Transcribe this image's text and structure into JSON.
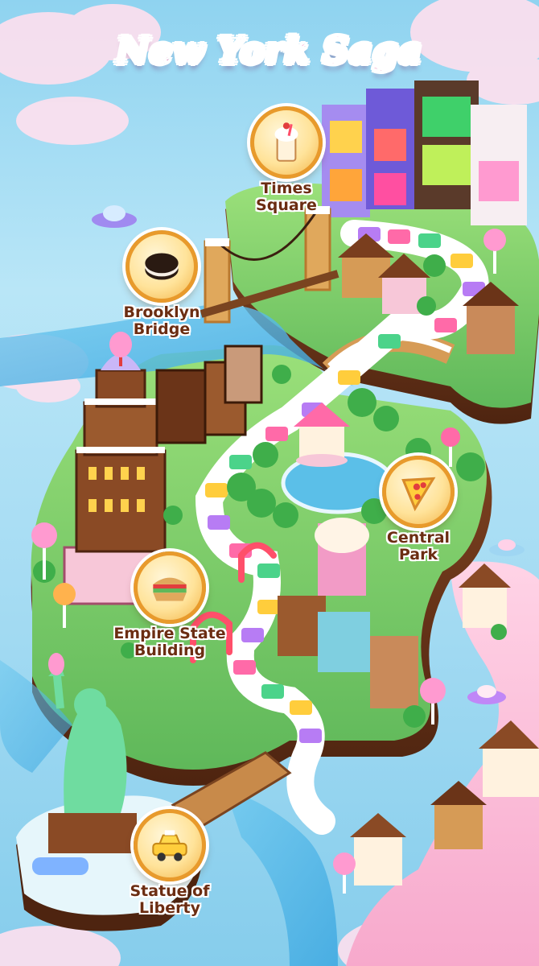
{
  "header": {
    "title": "New York Saga"
  },
  "locations": [
    {
      "id": "times-square",
      "label": "Times\nSquare",
      "icon": "milkshake-icon"
    },
    {
      "id": "brooklyn-bridge",
      "label": "Brooklyn\nBridge",
      "icon": "cookie-icon"
    },
    {
      "id": "central-park",
      "label": "Central\nPark",
      "icon": "pizza-icon"
    },
    {
      "id": "empire-state-building",
      "label": "Empire State\nBuilding",
      "icon": "sandwich-icon"
    },
    {
      "id": "statue-of-liberty",
      "label": "Statue of\nLiberty",
      "icon": "taxi-icon"
    }
  ],
  "colors": {
    "title_pink": "#ff6fb3",
    "badge_ring": "#e89a2c",
    "label_brown": "#6b2d12",
    "water": "#8fd3f0",
    "grass": "#7ccf6a"
  }
}
